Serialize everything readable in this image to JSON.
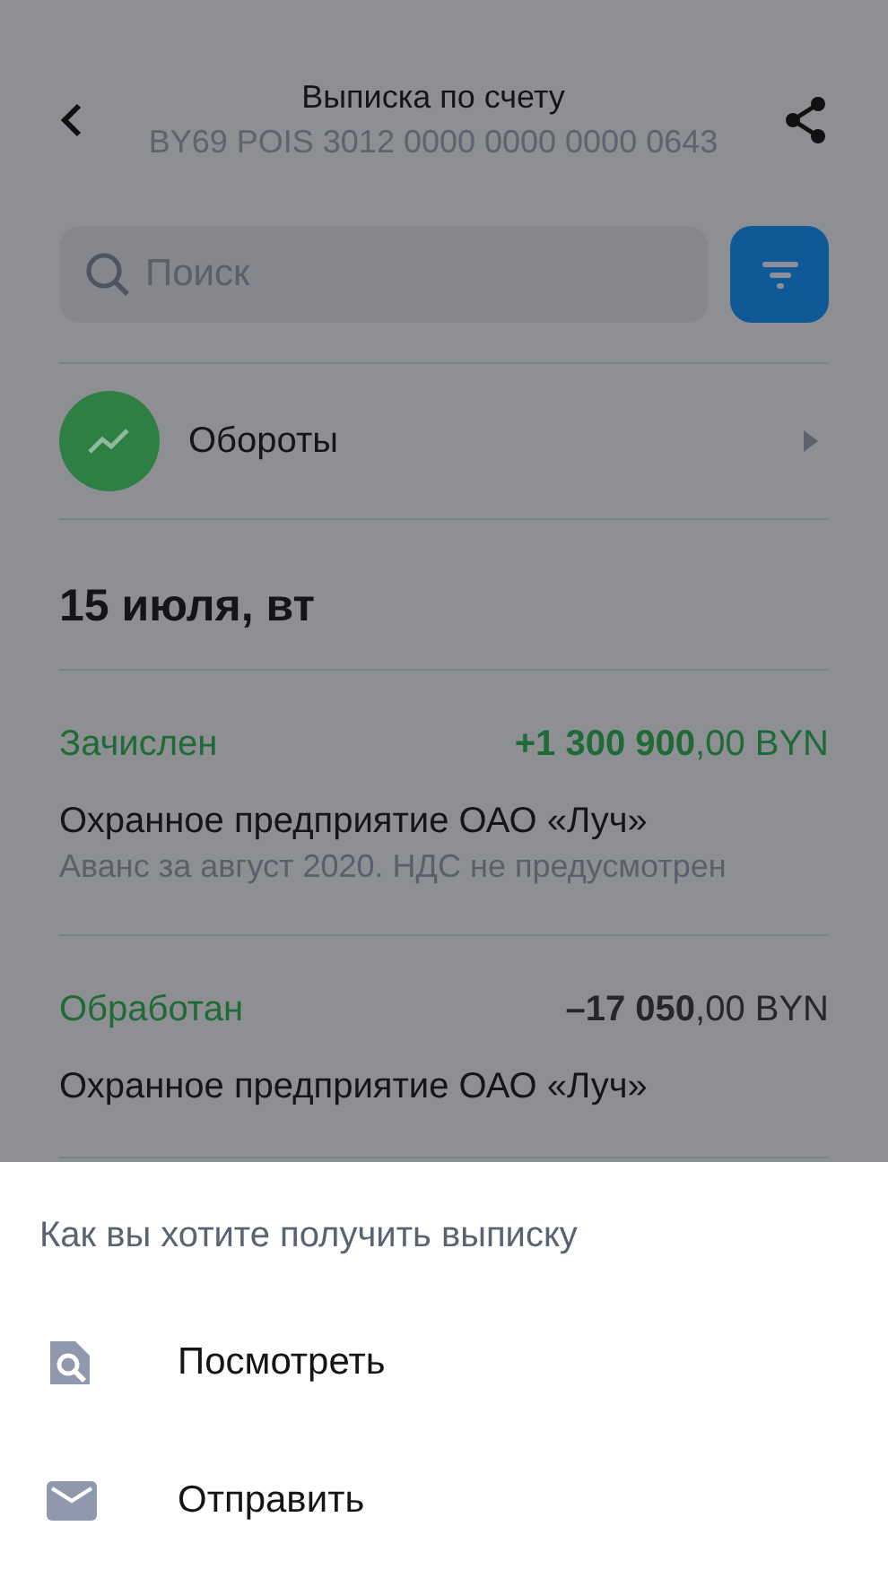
{
  "header": {
    "title": "Выписка по счету",
    "subtitle": "BY69 POIS 3012 0000 0000 0000 0643"
  },
  "search": {
    "placeholder": "Поиск"
  },
  "turnover": {
    "label": "Обороты"
  },
  "date": "15 июля, вт",
  "transactions": [
    {
      "status": "Зачислен",
      "kind": "credit",
      "amount": "**+1 300 900**,00 BYN",
      "name": "Охранное предприятие ОАО «Луч»",
      "description": "Аванс за август 2020. НДС не предусмотрен"
    },
    {
      "status": "Обработан",
      "kind": "debit",
      "amount": "**–17 050**,00 BYN",
      "name": "Охранное предприятие ОАО «Луч»"
    }
  ],
  "sheet": {
    "title": "Как вы хотите получить выписку",
    "options": [
      {
        "kind": "view",
        "label": "Посмотреть"
      },
      {
        "kind": "send",
        "label": "Отправить"
      }
    ]
  }
}
